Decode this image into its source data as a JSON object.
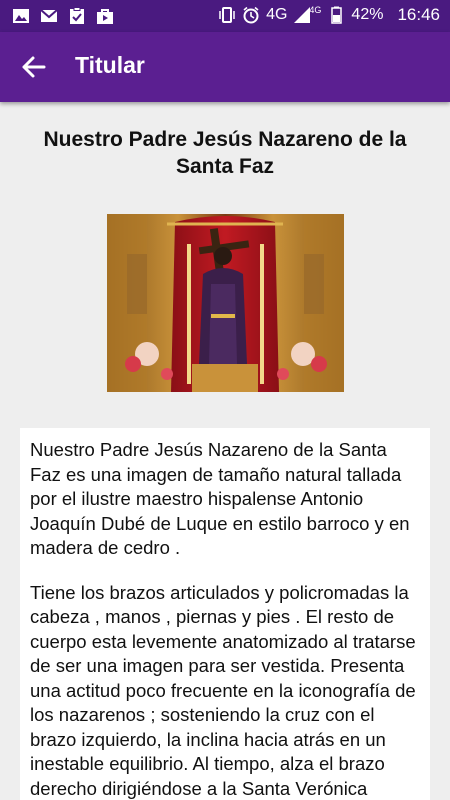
{
  "status_bar": {
    "network": "4G",
    "network_small": "4G",
    "battery": "42%",
    "time": "16:46"
  },
  "app_bar": {
    "title": "Titular"
  },
  "content": {
    "heading": "Nuestro Padre Jesús Nazareno de la Santa Faz",
    "paragraphs": [
      "Nuestro Padre Jesús Nazareno de la Santa Faz es una imagen de tamaño natural tallada por el ilustre maestro hispalense Antonio Joaquín Dubé de Luque en estilo barroco y en madera de cedro .",
      "Tiene los brazos articulados y policromadas la cabeza , manos , piernas y pies . El resto de cuerpo esta levemente anatomizado al tratarse de ser una imagen para ser vestida. Presenta una actitud poco frecuente en la iconografía de los nazarenos ; sosteniendo la cruz con el brazo izquierdo, la inclina hacia atrás en un inestable equilibrio. Al tiempo, alza el brazo derecho dirigiéndose a la Santa Verónica"
    ]
  },
  "colors": {
    "status_bar": "#4a1a80",
    "app_bar": "#5b1f91",
    "background": "#eeeeee"
  }
}
